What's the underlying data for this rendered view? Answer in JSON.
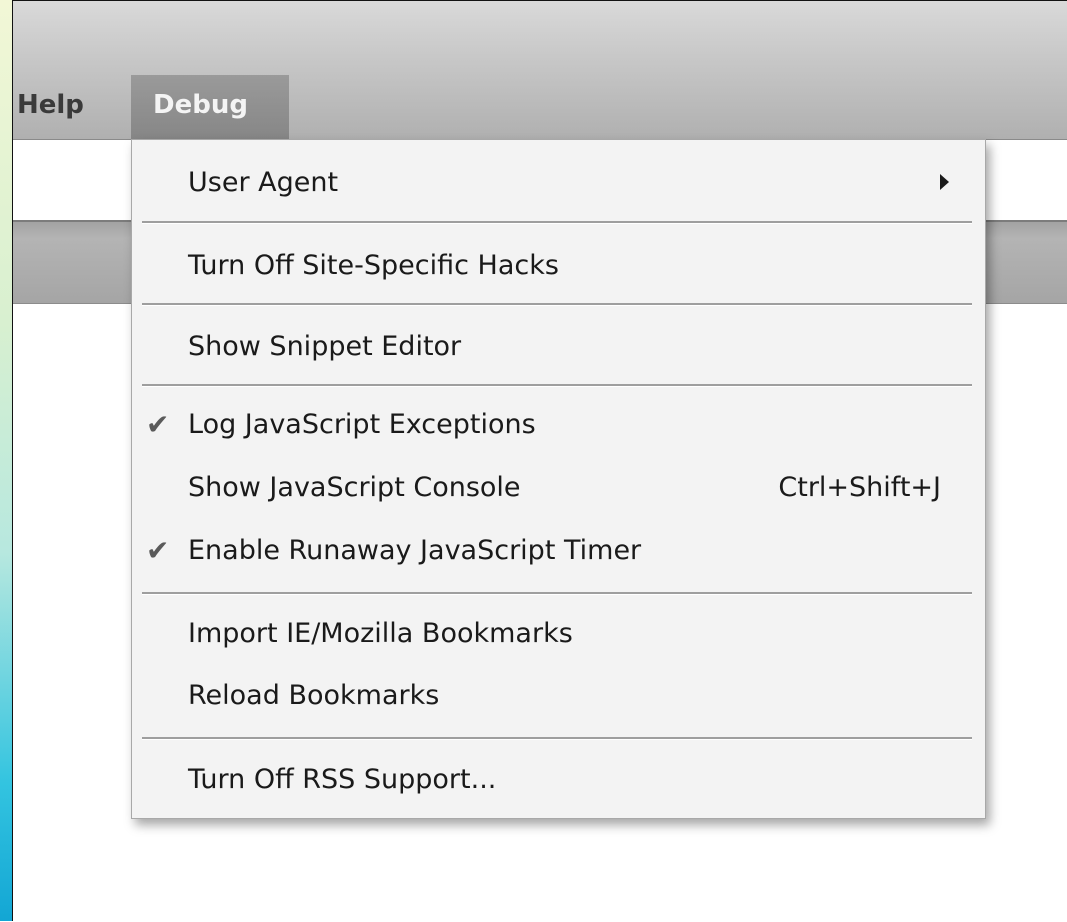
{
  "menubar": {
    "items": [
      {
        "label": "Help"
      },
      {
        "label": "Debug"
      }
    ]
  },
  "debug_menu": {
    "items": [
      {
        "label": "User Agent",
        "checked": false,
        "shortcut": "",
        "submenu": true
      },
      {
        "label": "Turn Off Site-Specific Hacks",
        "checked": false,
        "shortcut": "",
        "submenu": false
      },
      {
        "label": "Show Snippet Editor",
        "checked": false,
        "shortcut": "",
        "submenu": false
      },
      {
        "label": "Log JavaScript Exceptions",
        "checked": true,
        "shortcut": "",
        "submenu": false
      },
      {
        "label": "Show JavaScript Console",
        "checked": false,
        "shortcut": "Ctrl+Shift+J",
        "submenu": false
      },
      {
        "label": "Enable Runaway JavaScript Timer",
        "checked": true,
        "shortcut": "",
        "submenu": false
      },
      {
        "label": "Import IE/Mozilla Bookmarks",
        "checked": false,
        "shortcut": "",
        "submenu": false
      },
      {
        "label": "Reload Bookmarks",
        "checked": false,
        "shortcut": "",
        "submenu": false
      },
      {
        "label": "Turn Off RSS Support...",
        "checked": false,
        "shortcut": "",
        "submenu": false
      }
    ],
    "check_glyph": "✔"
  }
}
